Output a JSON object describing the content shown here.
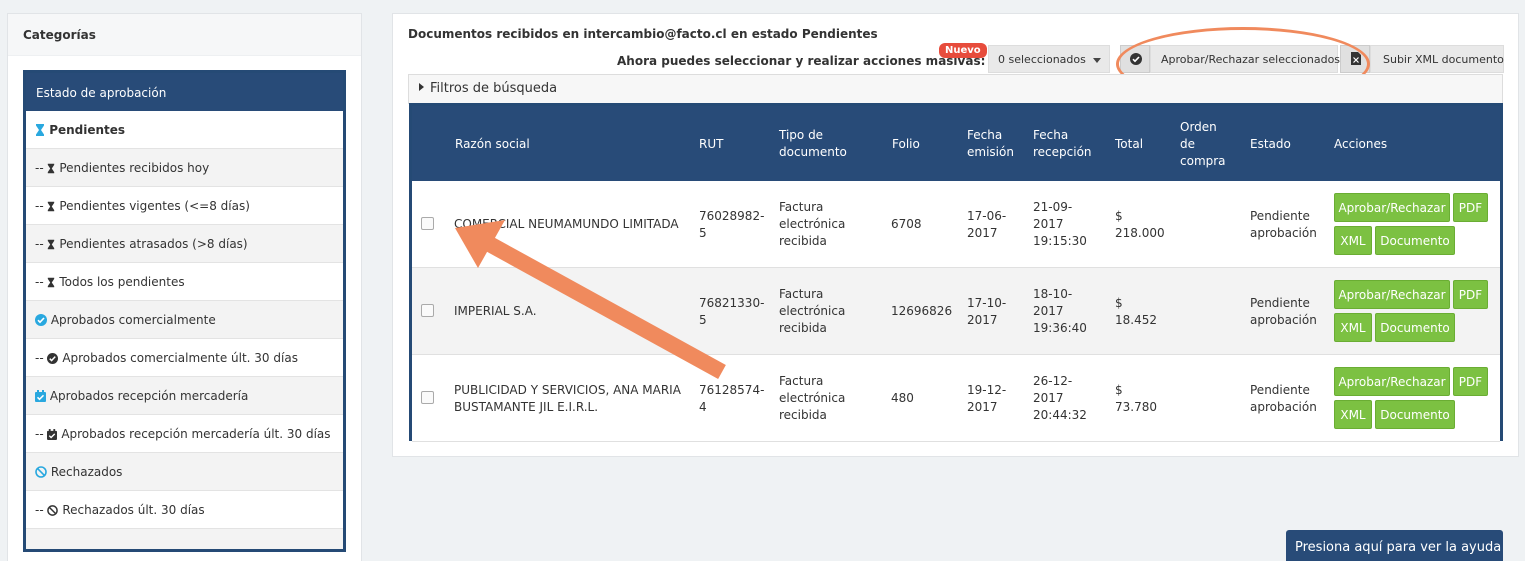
{
  "sidebar": {
    "title": "Categorías",
    "header": "Estado de aprobación",
    "items": [
      {
        "label": "Pendientes",
        "prefix": "",
        "icon": "hourglass-icon"
      },
      {
        "label": "Pendientes recibidos hoy",
        "prefix": "-- ",
        "icon": "hourglass-icon"
      },
      {
        "label": "Pendientes vigentes (<=8 días)",
        "prefix": "-- ",
        "icon": "hourglass-icon"
      },
      {
        "label": "Pendientes atrasados (>8 días)",
        "prefix": "-- ",
        "icon": "hourglass-icon"
      },
      {
        "label": "Todos los pendientes",
        "prefix": "-- ",
        "icon": "hourglass-icon"
      },
      {
        "label": "Aprobados comercialmente",
        "prefix": "",
        "icon": "check-circle-icon"
      },
      {
        "label": "Aprobados comercialmente últ. 30 días",
        "prefix": "-- ",
        "icon": "check-circle-icon"
      },
      {
        "label": "Aprobados recepción mercadería",
        "prefix": "",
        "icon": "calendar-check-icon"
      },
      {
        "label": "Aprobados recepción mercadería últ. 30 días",
        "prefix": "-- ",
        "icon": "calendar-check-icon"
      },
      {
        "label": "Rechazados",
        "prefix": "",
        "icon": "ban-icon"
      },
      {
        "label": "Rechazados últ. 30 días",
        "prefix": "-- ",
        "icon": "ban-icon"
      }
    ]
  },
  "main": {
    "title": "Documentos recibidos en intercambio@facto.cl en estado Pendientes",
    "mass_actions_label": "Ahora puedes seleccionar y realizar acciones masivas:",
    "new_badge": "Nuevo",
    "selected_dropdown": "0 seleccionados",
    "approve_selected_button": "Aprobar/Rechazar seleccionados",
    "upload_xml_button": "Subir XML documento",
    "filters_label": "Filtros de búsqueda"
  },
  "table": {
    "headers": {
      "razon": "Razón social",
      "rut": "RUT",
      "tipo": [
        "Tipo de",
        "documento"
      ],
      "folio": "Folio",
      "emision": [
        "Fecha",
        "emisión"
      ],
      "recepcion": [
        "Fecha",
        "recepción"
      ],
      "total": "Total",
      "orden": [
        "Orden",
        "de",
        "compra"
      ],
      "estado": "Estado",
      "acciones": "Acciones"
    },
    "rows": [
      {
        "razon": [
          "COMERCIAL NEUMAMUNDO LIMITADA"
        ],
        "rut": [
          "76028982-",
          "5"
        ],
        "tipo": [
          "Factura",
          "electrónica",
          "recibida"
        ],
        "folio": "6708",
        "emision": [
          "17-06-",
          "2017"
        ],
        "recepcion": [
          "21-09-",
          "2017",
          "19:15:30"
        ],
        "total": [
          "$",
          "218.000"
        ],
        "estado": [
          "Pendiente",
          "aprobación"
        ]
      },
      {
        "razon": [
          "IMPERIAL S.A."
        ],
        "rut": [
          "76821330-",
          "5"
        ],
        "tipo": [
          "Factura",
          "electrónica",
          "recibida"
        ],
        "folio": "12696826",
        "emision": [
          "17-10-",
          "2017"
        ],
        "recepcion": [
          "18-10-",
          "2017",
          "19:36:40"
        ],
        "total": [
          "$",
          "18.452"
        ],
        "estado": [
          "Pendiente",
          "aprobación"
        ]
      },
      {
        "razon": [
          "PUBLICIDAD Y SERVICIOS, ANA MARIA",
          "BUSTAMANTE JIL E.I.R.L."
        ],
        "rut": [
          "76128574-",
          "4"
        ],
        "tipo": [
          "Factura",
          "electrónica",
          "recibida"
        ],
        "folio": "480",
        "emision": [
          "19-12-",
          "2017"
        ],
        "recepcion": [
          "26-12-",
          "2017",
          "20:44:32"
        ],
        "total": [
          "$",
          "73.780"
        ],
        "estado": [
          "Pendiente",
          "aprobación"
        ]
      }
    ],
    "actions": {
      "approve": "Aprobar/Rechazar",
      "pdf": "PDF",
      "xml": "XML",
      "document": "Documento"
    }
  },
  "help_button": "Presiona aquí para ver la ayuda",
  "colors": {
    "navy": "#284b78",
    "green": "#7cc142",
    "badge_red": "#e74c3c",
    "annotation_orange": "#f08a5d",
    "icon_blue": "#29a8df"
  }
}
